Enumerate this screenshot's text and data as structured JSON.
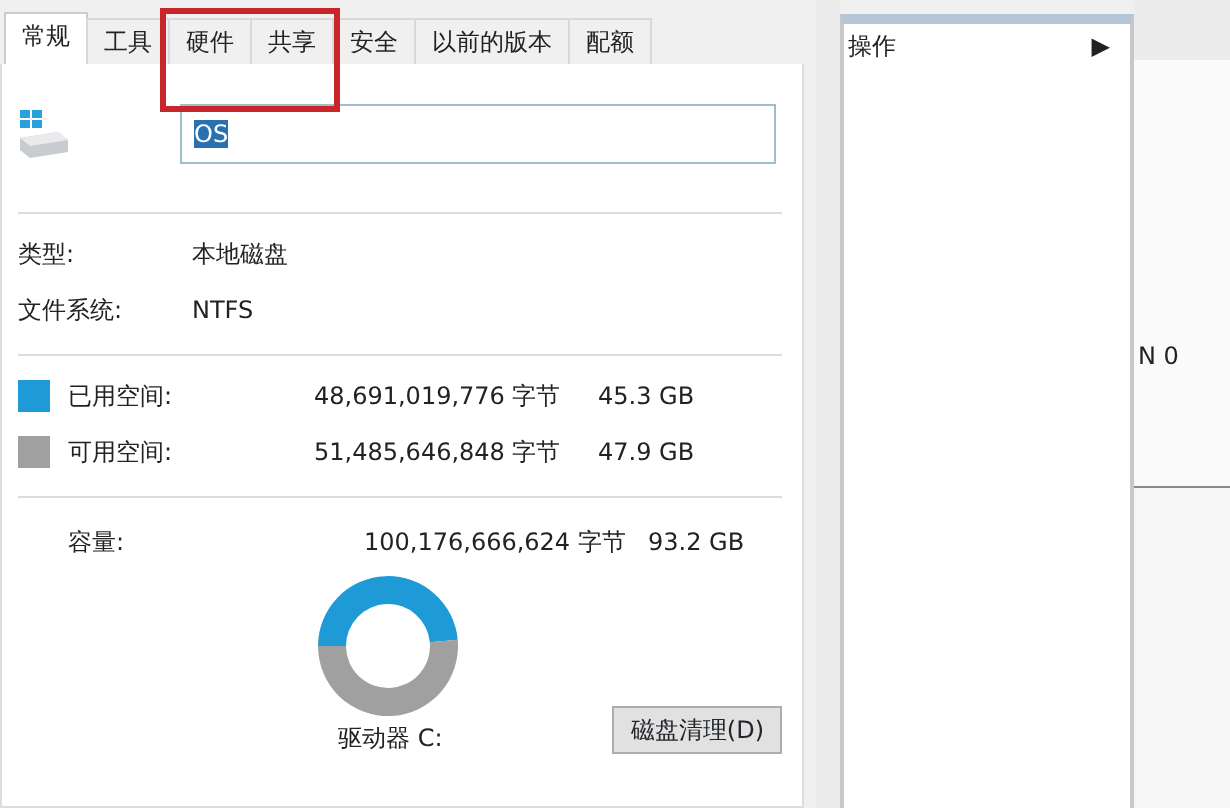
{
  "tabs": [
    {
      "label": "常规",
      "selected": true
    },
    {
      "label": "工具",
      "selected": false
    },
    {
      "label": "硬件",
      "selected": false
    },
    {
      "label": "共享",
      "selected": false
    },
    {
      "label": "安全",
      "selected": false
    },
    {
      "label": "以前的版本",
      "selected": false
    },
    {
      "label": "配额",
      "selected": false
    }
  ],
  "name_field": {
    "value": "OS"
  },
  "info": [
    {
      "label": "类型:",
      "value": "本地磁盘"
    },
    {
      "label": "文件系统:",
      "value": "NTFS"
    }
  ],
  "space": [
    {
      "label": "已用空间:",
      "bytes": "48,691,019,776 字节",
      "size": "45.3 GB",
      "color": "#1e9ad6"
    },
    {
      "label": "可用空间:",
      "bytes": "51,485,646,848 字节",
      "size": "47.9 GB",
      "color": "#a0a0a0"
    }
  ],
  "capacity": {
    "label": "容量:",
    "bytes": "100,176,666,624 字节",
    "size": "93.2 GB"
  },
  "drive_label": "驱动器 C:",
  "cleanup_button": "磁盘清理(D)",
  "context_menu": {
    "items": [
      {
        "label": "操作",
        "arrow": "▶"
      }
    ]
  },
  "background_text": "N 0"
}
